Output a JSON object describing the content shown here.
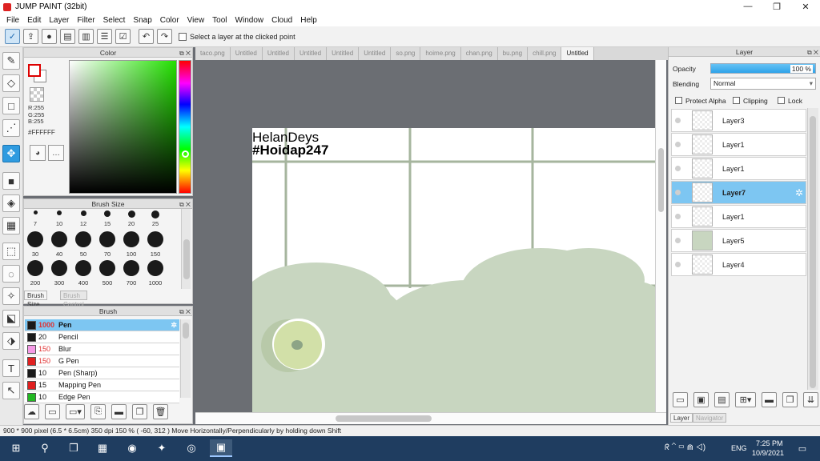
{
  "window": {
    "title": "JUMP PAINT (32bit)",
    "controls": [
      "—",
      "❐",
      "✕"
    ]
  },
  "menu": [
    "File",
    "Edit",
    "Layer",
    "Filter",
    "Select",
    "Snap",
    "Color",
    "View",
    "Tool",
    "Window",
    "Cloud",
    "Help"
  ],
  "toolbar": {
    "select_layer_label": "Select a layer at the clicked point"
  },
  "color_panel": {
    "title": "Color",
    "r": "R:255",
    "g": "G:255",
    "b": "B:255",
    "hex": "#FFFFFF",
    "accent_hex": "#22e000"
  },
  "brush_size_panel": {
    "title": "Brush Size",
    "row1": [
      "7",
      "10",
      "12",
      "15",
      "20",
      "25"
    ],
    "row2": [
      "30",
      "40",
      "50",
      "70",
      "100",
      "150"
    ],
    "row3": [
      "200",
      "300",
      "400",
      "500",
      "700",
      "1000"
    ],
    "tabs": [
      "Brush Size",
      "Brush Control"
    ]
  },
  "brush_panel": {
    "title": "Brush",
    "items": [
      {
        "size": "1000",
        "name": "Pen",
        "color": "#1a1a1a"
      },
      {
        "size": "20",
        "name": "Pencil",
        "color": "#1a1a1a"
      },
      {
        "size": "150",
        "name": "Blur",
        "color": "#f59ae6"
      },
      {
        "size": "150",
        "name": "G Pen",
        "color": "#e02020"
      },
      {
        "size": "10",
        "name": "Pen (Sharp)",
        "color": "#1a1a1a"
      },
      {
        "size": "15",
        "name": "Mapping Pen",
        "color": "#e02020"
      },
      {
        "size": "10",
        "name": "Edge Pen",
        "color": "#22b822"
      }
    ]
  },
  "doc_tabs": [
    "taco.png",
    "Untitled",
    "Untitled",
    "Untitled",
    "Untitled",
    "Untitled",
    "so.png",
    "hoime.png",
    "chan.png",
    "bu.png",
    "chill.png",
    "Untitled"
  ],
  "canvas": {
    "watermark_line1": "HelanDeys",
    "watermark_line2": "#Hoidap247"
  },
  "layer_panel": {
    "title": "Layer",
    "opacity_label": "Opacity",
    "opacity_value": "100 %",
    "blending_label": "Blending",
    "blending_value": "Normal",
    "protect_alpha": "Protect Alpha",
    "clipping": "Clipping",
    "lock": "Lock",
    "layers": [
      "Layer3",
      "Layer1",
      "Layer1",
      "Layer7",
      "Layer1",
      "Layer5",
      "Layer4"
    ],
    "bottom_tabs": [
      "Layer",
      "Navigator"
    ]
  },
  "status": {
    "text": "900 * 900 pixel  (6.5 * 6.5cm)  350 dpi  150 %  ( -60, 312 )  Move Horizontally/Perpendicularly by holding down Shift"
  },
  "taskbar": {
    "time": "7:25 PM",
    "date": "10/9/2021",
    "lang": "ENG"
  }
}
